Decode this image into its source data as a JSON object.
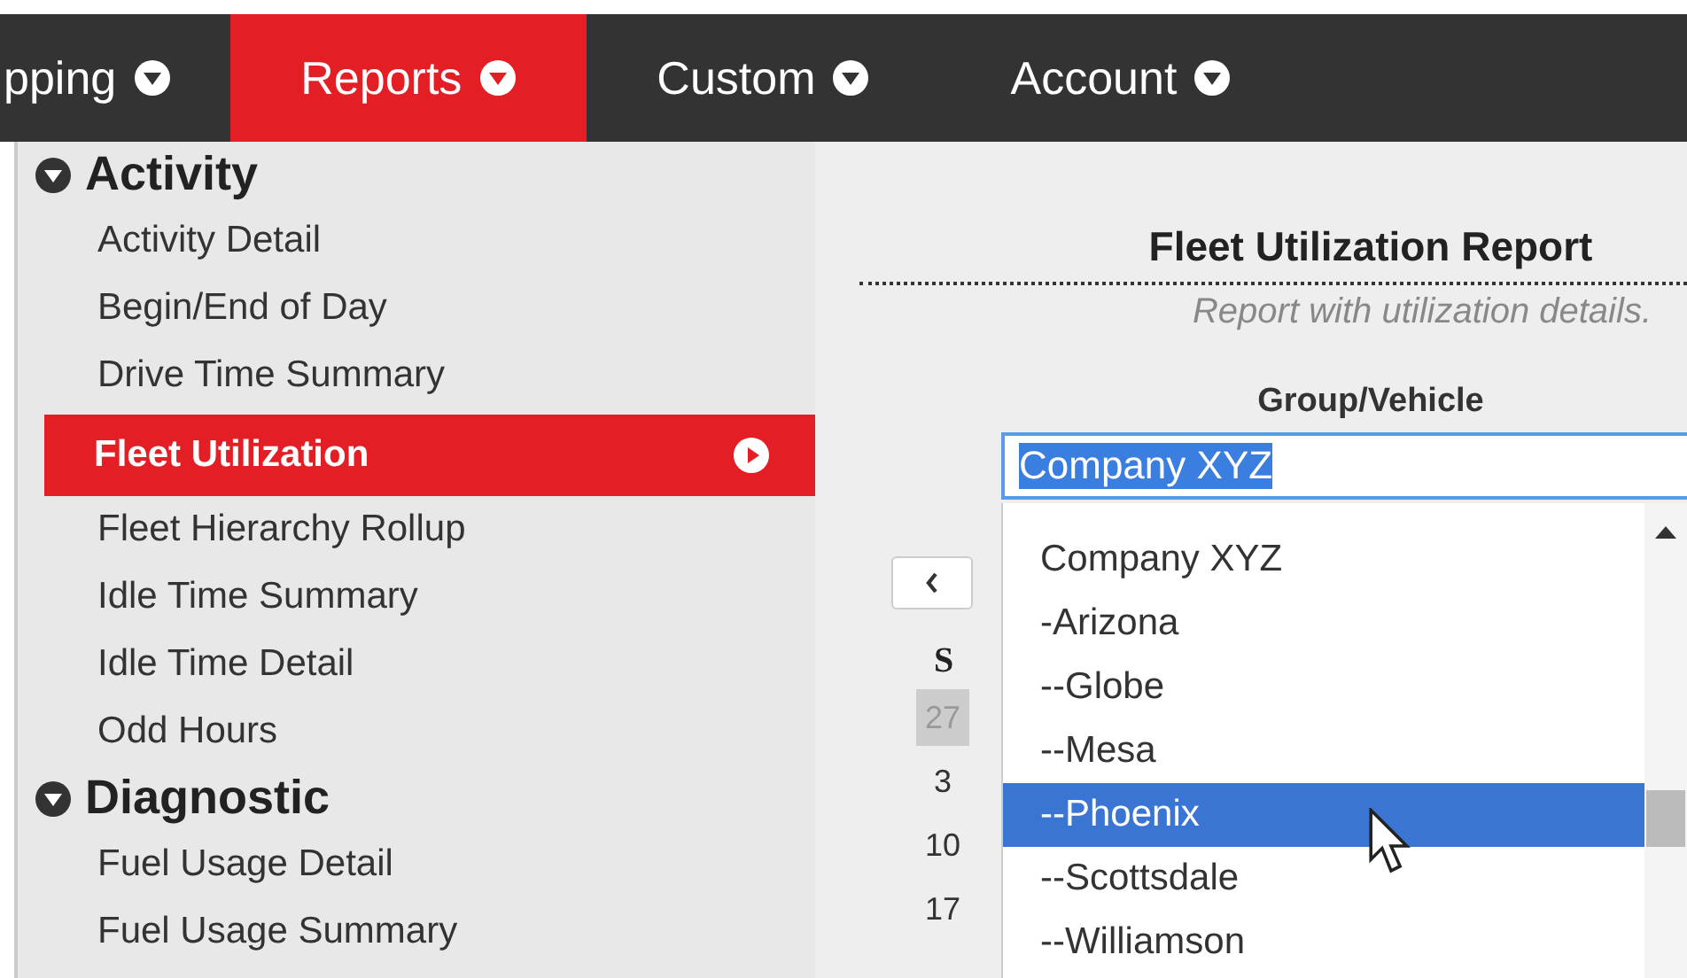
{
  "nav": {
    "items": [
      {
        "label": "pping",
        "selected": false
      },
      {
        "label": "Reports",
        "selected": true
      },
      {
        "label": "Custom",
        "selected": false
      },
      {
        "label": "Account",
        "selected": false
      }
    ]
  },
  "menu": {
    "sections": [
      {
        "title": "Activity",
        "expanded": true,
        "items": [
          {
            "label": "Activity Detail",
            "selected": false
          },
          {
            "label": "Begin/End of Day",
            "selected": false
          },
          {
            "label": "Drive Time Summary",
            "selected": false
          },
          {
            "label": "Fleet Utilization",
            "selected": true
          },
          {
            "label": "Fleet Hierarchy Rollup",
            "selected": false
          },
          {
            "label": "Idle Time Summary",
            "selected": false
          },
          {
            "label": "Idle Time Detail",
            "selected": false
          },
          {
            "label": "Odd Hours",
            "selected": false
          }
        ]
      },
      {
        "title": "Diagnostic",
        "expanded": true,
        "items": [
          {
            "label": "Fuel Usage Detail",
            "selected": false
          },
          {
            "label": "Fuel Usage Summary",
            "selected": false
          }
        ]
      }
    ]
  },
  "report": {
    "title": "Fleet Utilization Report",
    "subtitle": "Report with utilization details.",
    "field_label": "Group/Vehicle",
    "value": "Company XYZ",
    "options": [
      {
        "label": "Company XYZ",
        "highlighted": false
      },
      {
        "label": "-Arizona",
        "highlighted": false
      },
      {
        "label": "--Globe",
        "highlighted": false
      },
      {
        "label": "--Mesa",
        "highlighted": false
      },
      {
        "label": "--Phoenix",
        "highlighted": true
      },
      {
        "label": "--Scottsdale",
        "highlighted": false
      },
      {
        "label": "--Williamson",
        "highlighted": false
      }
    ],
    "calendar": {
      "weekday": "S",
      "days": [
        {
          "label": "27",
          "other_month": true
        },
        {
          "label": "3",
          "other_month": false
        },
        {
          "label": "10",
          "other_month": false
        },
        {
          "label": "17",
          "other_month": false
        }
      ]
    }
  }
}
